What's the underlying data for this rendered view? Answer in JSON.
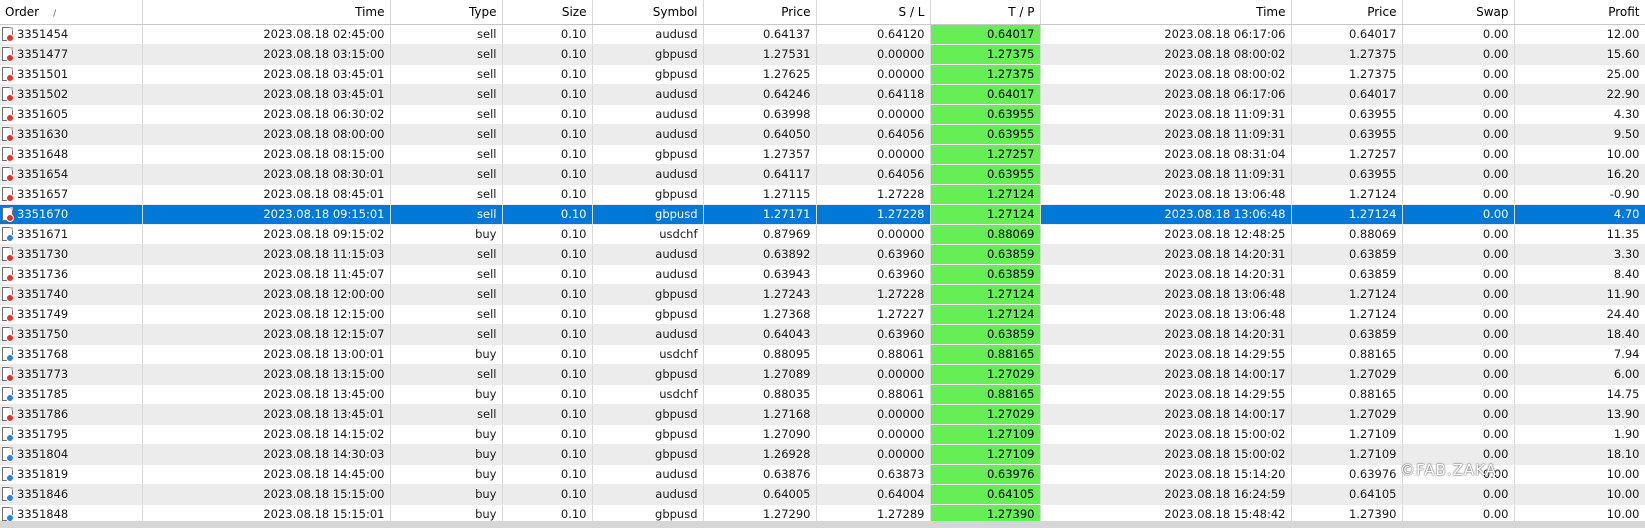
{
  "columns": [
    "Order",
    "Time",
    "Type",
    "Size",
    "Symbol",
    "Price",
    "S / L",
    "T / P",
    "Time",
    "Price",
    "Swap",
    "Profit"
  ],
  "sort_indicator": "/",
  "rows": [
    {
      "order": "3351454",
      "open_time": "2023.08.18 02:45:00",
      "type": "sell",
      "size": "0.10",
      "symbol": "audusd",
      "price": "0.64137",
      "sl": "0.64120",
      "tp": "0.64017",
      "close_time": "2023.08.18 06:17:06",
      "close_price": "0.64017",
      "swap": "0.00",
      "profit": "12.00"
    },
    {
      "order": "3351477",
      "open_time": "2023.08.18 03:15:00",
      "type": "sell",
      "size": "0.10",
      "symbol": "gbpusd",
      "price": "1.27531",
      "sl": "0.00000",
      "tp": "1.27375",
      "close_time": "2023.08.18 08:00:02",
      "close_price": "1.27375",
      "swap": "0.00",
      "profit": "15.60"
    },
    {
      "order": "3351501",
      "open_time": "2023.08.18 03:45:01",
      "type": "sell",
      "size": "0.10",
      "symbol": "gbpusd",
      "price": "1.27625",
      "sl": "0.00000",
      "tp": "1.27375",
      "close_time": "2023.08.18 08:00:02",
      "close_price": "1.27375",
      "swap": "0.00",
      "profit": "25.00"
    },
    {
      "order": "3351502",
      "open_time": "2023.08.18 03:45:01",
      "type": "sell",
      "size": "0.10",
      "symbol": "audusd",
      "price": "0.64246",
      "sl": "0.64118",
      "tp": "0.64017",
      "close_time": "2023.08.18 06:17:06",
      "close_price": "0.64017",
      "swap": "0.00",
      "profit": "22.90"
    },
    {
      "order": "3351605",
      "open_time": "2023.08.18 06:30:02",
      "type": "sell",
      "size": "0.10",
      "symbol": "audusd",
      "price": "0.63998",
      "sl": "0.00000",
      "tp": "0.63955",
      "close_time": "2023.08.18 11:09:31",
      "close_price": "0.63955",
      "swap": "0.00",
      "profit": "4.30"
    },
    {
      "order": "3351630",
      "open_time": "2023.08.18 08:00:00",
      "type": "sell",
      "size": "0.10",
      "symbol": "audusd",
      "price": "0.64050",
      "sl": "0.64056",
      "tp": "0.63955",
      "close_time": "2023.08.18 11:09:31",
      "close_price": "0.63955",
      "swap": "0.00",
      "profit": "9.50"
    },
    {
      "order": "3351648",
      "open_time": "2023.08.18 08:15:00",
      "type": "sell",
      "size": "0.10",
      "symbol": "gbpusd",
      "price": "1.27357",
      "sl": "0.00000",
      "tp": "1.27257",
      "close_time": "2023.08.18 08:31:04",
      "close_price": "1.27257",
      "swap": "0.00",
      "profit": "10.00"
    },
    {
      "order": "3351654",
      "open_time": "2023.08.18 08:30:01",
      "type": "sell",
      "size": "0.10",
      "symbol": "audusd",
      "price": "0.64117",
      "sl": "0.64056",
      "tp": "0.63955",
      "close_time": "2023.08.18 11:09:31",
      "close_price": "0.63955",
      "swap": "0.00",
      "profit": "16.20"
    },
    {
      "order": "3351657",
      "open_time": "2023.08.18 08:45:01",
      "type": "sell",
      "size": "0.10",
      "symbol": "gbpusd",
      "price": "1.27115",
      "sl": "1.27228",
      "tp": "1.27124",
      "close_time": "2023.08.18 13:06:48",
      "close_price": "1.27124",
      "swap": "0.00",
      "profit": "-0.90"
    },
    {
      "order": "3351670",
      "open_time": "2023.08.18 09:15:01",
      "type": "sell",
      "size": "0.10",
      "symbol": "gbpusd",
      "price": "1.27171",
      "sl": "1.27228",
      "tp": "1.27124",
      "close_time": "2023.08.18 13:06:48",
      "close_price": "1.27124",
      "swap": "0.00",
      "profit": "4.70",
      "selected": true
    },
    {
      "order": "3351671",
      "open_time": "2023.08.18 09:15:02",
      "type": "buy",
      "size": "0.10",
      "symbol": "usdchf",
      "price": "0.87969",
      "sl": "0.00000",
      "tp": "0.88069",
      "close_time": "2023.08.18 12:48:25",
      "close_price": "0.88069",
      "swap": "0.00",
      "profit": "11.35"
    },
    {
      "order": "3351730",
      "open_time": "2023.08.18 11:15:03",
      "type": "sell",
      "size": "0.10",
      "symbol": "audusd",
      "price": "0.63892",
      "sl": "0.63960",
      "tp": "0.63859",
      "close_time": "2023.08.18 14:20:31",
      "close_price": "0.63859",
      "swap": "0.00",
      "profit": "3.30"
    },
    {
      "order": "3351736",
      "open_time": "2023.08.18 11:45:07",
      "type": "sell",
      "size": "0.10",
      "symbol": "audusd",
      "price": "0.63943",
      "sl": "0.63960",
      "tp": "0.63859",
      "close_time": "2023.08.18 14:20:31",
      "close_price": "0.63859",
      "swap": "0.00",
      "profit": "8.40"
    },
    {
      "order": "3351740",
      "open_time": "2023.08.18 12:00:00",
      "type": "sell",
      "size": "0.10",
      "symbol": "gbpusd",
      "price": "1.27243",
      "sl": "1.27228",
      "tp": "1.27124",
      "close_time": "2023.08.18 13:06:48",
      "close_price": "1.27124",
      "swap": "0.00",
      "profit": "11.90"
    },
    {
      "order": "3351749",
      "open_time": "2023.08.18 12:15:00",
      "type": "sell",
      "size": "0.10",
      "symbol": "gbpusd",
      "price": "1.27368",
      "sl": "1.27227",
      "tp": "1.27124",
      "close_time": "2023.08.18 13:06:48",
      "close_price": "1.27124",
      "swap": "0.00",
      "profit": "24.40"
    },
    {
      "order": "3351750",
      "open_time": "2023.08.18 12:15:07",
      "type": "sell",
      "size": "0.10",
      "symbol": "audusd",
      "price": "0.64043",
      "sl": "0.63960",
      "tp": "0.63859",
      "close_time": "2023.08.18 14:20:31",
      "close_price": "0.63859",
      "swap": "0.00",
      "profit": "18.40"
    },
    {
      "order": "3351768",
      "open_time": "2023.08.18 13:00:01",
      "type": "buy",
      "size": "0.10",
      "symbol": "usdchf",
      "price": "0.88095",
      "sl": "0.88061",
      "tp": "0.88165",
      "close_time": "2023.08.18 14:29:55",
      "close_price": "0.88165",
      "swap": "0.00",
      "profit": "7.94"
    },
    {
      "order": "3351773",
      "open_time": "2023.08.18 13:15:00",
      "type": "sell",
      "size": "0.10",
      "symbol": "gbpusd",
      "price": "1.27089",
      "sl": "0.00000",
      "tp": "1.27029",
      "close_time": "2023.08.18 14:00:17",
      "close_price": "1.27029",
      "swap": "0.00",
      "profit": "6.00"
    },
    {
      "order": "3351785",
      "open_time": "2023.08.18 13:45:00",
      "type": "buy",
      "size": "0.10",
      "symbol": "usdchf",
      "price": "0.88035",
      "sl": "0.88061",
      "tp": "0.88165",
      "close_time": "2023.08.18 14:29:55",
      "close_price": "0.88165",
      "swap": "0.00",
      "profit": "14.75"
    },
    {
      "order": "3351786",
      "open_time": "2023.08.18 13:45:01",
      "type": "sell",
      "size": "0.10",
      "symbol": "gbpusd",
      "price": "1.27168",
      "sl": "0.00000",
      "tp": "1.27029",
      "close_time": "2023.08.18 14:00:17",
      "close_price": "1.27029",
      "swap": "0.00",
      "profit": "13.90"
    },
    {
      "order": "3351795",
      "open_time": "2023.08.18 14:15:02",
      "type": "buy",
      "size": "0.10",
      "symbol": "gbpusd",
      "price": "1.27090",
      "sl": "0.00000",
      "tp": "1.27109",
      "close_time": "2023.08.18 15:00:02",
      "close_price": "1.27109",
      "swap": "0.00",
      "profit": "1.90"
    },
    {
      "order": "3351804",
      "open_time": "2023.08.18 14:30:03",
      "type": "buy",
      "size": "0.10",
      "symbol": "gbpusd",
      "price": "1.26928",
      "sl": "0.00000",
      "tp": "1.27109",
      "close_time": "2023.08.18 15:00:02",
      "close_price": "1.27109",
      "swap": "0.00",
      "profit": "18.10"
    },
    {
      "order": "3351819",
      "open_time": "2023.08.18 14:45:00",
      "type": "buy",
      "size": "0.10",
      "symbol": "audusd",
      "price": "0.63876",
      "sl": "0.63873",
      "tp": "0.63976",
      "close_time": "2023.08.18 15:14:20",
      "close_price": "0.63976",
      "swap": "0.00",
      "profit": "10.00"
    },
    {
      "order": "3351846",
      "open_time": "2023.08.18 15:15:00",
      "type": "buy",
      "size": "0.10",
      "symbol": "audusd",
      "price": "0.64005",
      "sl": "0.64004",
      "tp": "0.64105",
      "close_time": "2023.08.18 16:24:59",
      "close_price": "0.64105",
      "swap": "0.00",
      "profit": "10.00"
    },
    {
      "order": "3351848",
      "open_time": "2023.08.18 15:15:01",
      "type": "buy",
      "size": "0.10",
      "symbol": "gbpusd",
      "price": "1.27290",
      "sl": "1.27289",
      "tp": "1.27390",
      "close_time": "2023.08.18 15:48:42",
      "close_price": "1.27390",
      "swap": "0.00",
      "profit": "10.00"
    }
  ],
  "colors": {
    "tp_highlight": "#66ee55",
    "selection": "#0078d7",
    "sell_icon": "#e8302a",
    "buy_icon": "#2d7fe0"
  },
  "icons": {
    "sell": "doc-sell-icon",
    "buy": "doc-buy-icon"
  },
  "watermark": "©FAB.ZAKA"
}
